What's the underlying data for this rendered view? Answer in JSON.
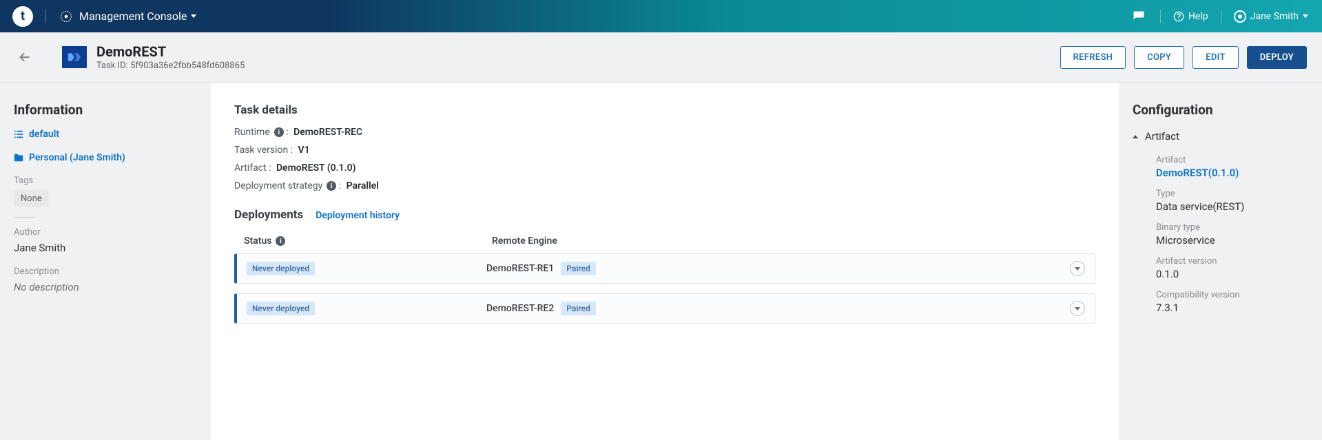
{
  "topbar": {
    "logo_letter": "t",
    "console_label": "Management Console",
    "help_label": "Help",
    "user_name": "Jane Smith"
  },
  "header": {
    "title": "DemoREST",
    "task_id_label": "Task ID:",
    "task_id": "5f903a36e2fbb548fd608865",
    "refresh": "REFRESH",
    "copy": "COPY",
    "edit": "EDIT",
    "deploy": "DEPLOY"
  },
  "left": {
    "title": "Information",
    "default_link": "default",
    "personal_link": "Personal (Jane Smith)",
    "tags_label": "Tags",
    "tags_none": "None",
    "author_label": "Author",
    "author_value": "Jane Smith",
    "desc_label": "Description",
    "desc_value": "No description"
  },
  "details": {
    "title": "Task details",
    "runtime_label": "Runtime",
    "runtime_value": "DemoREST-REC",
    "version_label": "Task version",
    "version_value": "V1",
    "artifact_label": "Artifact",
    "artifact_value": "DemoREST (0.1.0)",
    "strategy_label": "Deployment strategy",
    "strategy_value": "Parallel"
  },
  "deployments": {
    "title": "Deployments",
    "history_link": "Deployment history",
    "col_status": "Status",
    "col_engine": "Remote Engine",
    "rows": [
      {
        "status": "Never deployed",
        "engine": "DemoREST-RE1",
        "pair": "Paired"
      },
      {
        "status": "Never deployed",
        "engine": "DemoREST-RE2",
        "pair": "Paired"
      }
    ]
  },
  "config": {
    "title": "Configuration",
    "artifact_section": "Artifact",
    "artifact_label": "Artifact",
    "artifact_link": "DemoREST(0.1.0)",
    "type_label": "Type",
    "type_value": "Data service(REST)",
    "binary_label": "Binary type",
    "binary_value": "Microservice",
    "artver_label": "Artifact version",
    "artver_value": "0.1.0",
    "compat_label": "Compatibility version",
    "compat_value": "7.3.1"
  }
}
